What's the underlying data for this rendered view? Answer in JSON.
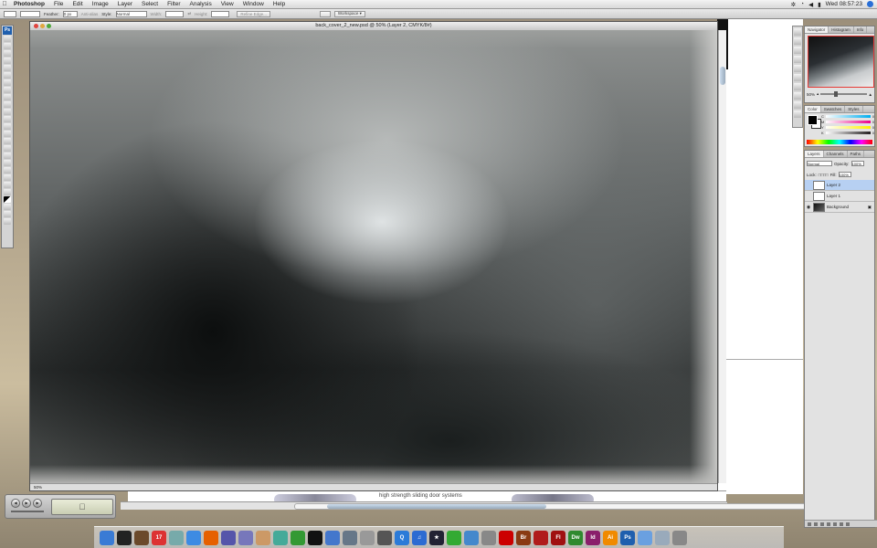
{
  "menubar": {
    "app": "Photoshop",
    "menus": [
      "File",
      "Edit",
      "Image",
      "Layer",
      "Select",
      "Filter",
      "Analysis",
      "View",
      "Window",
      "Help"
    ],
    "clock": "Wed 08:57:23"
  },
  "options": {
    "feather_label": "Feather:",
    "feather_value": "0 px",
    "antialias_label": "Anti-alias",
    "style_label": "Style:",
    "style_value": "Normal",
    "width_label": "Width:",
    "height_label": "Height:",
    "refine_edge": "Refine Edge...",
    "workspace": "Workspace ▾"
  },
  "tools": {
    "logo": "Ps"
  },
  "document": {
    "title": "back_cover_2_new.psd @ 50% (Layer 2, CMYK/8#)",
    "status": "50%"
  },
  "lower_document": {
    "caption": "high strength sliding door systems"
  },
  "panels": {
    "navigator_tabs": [
      "Navigator",
      "Histogram",
      "Info"
    ],
    "zoom_value": "50%",
    "color_tabs": [
      "Color",
      "Swatches",
      "Styles"
    ],
    "color_channels": [
      {
        "label": "C",
        "value": "0",
        "color": "#00aeef"
      },
      {
        "label": "M",
        "value": "0",
        "color": "#ec008c"
      },
      {
        "label": "Y",
        "value": "0",
        "color": "#fff200"
      },
      {
        "label": "K",
        "value": "0",
        "color": "#231f20"
      }
    ],
    "layers_tabs": [
      "Layers",
      "Channels",
      "Paths"
    ],
    "blend_mode": "Normal",
    "opacity_label": "Opacity:",
    "opacity_value": "100%",
    "lock_label": "Lock:",
    "fill_label": "Fill:",
    "fill_value": "100%",
    "layers": [
      {
        "name": "Layer 2",
        "selected": true
      },
      {
        "name": "Layer 1",
        "selected": false
      },
      {
        "name": "Background",
        "selected": false
      }
    ]
  },
  "dock": {
    "items": [
      {
        "name": "finder-icon",
        "label": "",
        "color": "#3a7bd5"
      },
      {
        "name": "dashboard-icon",
        "label": "",
        "color": "#222"
      },
      {
        "name": "books-icon",
        "label": "",
        "color": "#6b4a2b"
      },
      {
        "name": "ical-icon",
        "label": "17",
        "color": "#d33"
      },
      {
        "name": "preview-icon",
        "label": "",
        "color": "#7aa"
      },
      {
        "name": "safari-icon",
        "label": "",
        "color": "#3d8be3"
      },
      {
        "name": "firefox-icon",
        "label": "",
        "color": "#e66000"
      },
      {
        "name": "ichat-icon",
        "label": "",
        "color": "#55a"
      },
      {
        "name": "mail-icon",
        "label": "",
        "color": "#77b"
      },
      {
        "name": "photo-icon",
        "label": "",
        "color": "#c96"
      },
      {
        "name": "itunes-icon",
        "label": "",
        "color": "#4a9"
      },
      {
        "name": "adium-icon",
        "label": "",
        "color": "#393"
      },
      {
        "name": "terminal-icon",
        "label": "",
        "color": "#111"
      },
      {
        "name": "network-icon",
        "label": "",
        "color": "#47c"
      },
      {
        "name": "xcode-icon",
        "label": "",
        "color": "#678"
      },
      {
        "name": "text-icon",
        "label": "",
        "color": "#999"
      },
      {
        "name": "printer-icon",
        "label": "",
        "color": "#555"
      },
      {
        "name": "quicktime-icon",
        "label": "Q",
        "color": "#2b7bd8"
      },
      {
        "name": "music-icon",
        "label": "♫",
        "color": "#2c6bd2"
      },
      {
        "name": "star-icon",
        "label": "★",
        "color": "#223"
      },
      {
        "name": "chat-icon",
        "label": "",
        "color": "#3a3"
      },
      {
        "name": "pen-icon",
        "label": "",
        "color": "#48c"
      },
      {
        "name": "gear-icon",
        "label": "",
        "color": "#888"
      },
      {
        "name": "acrobat-icon",
        "label": "",
        "color": "#c00"
      },
      {
        "name": "bridge-icon",
        "label": "Br",
        "color": "#8a3a13"
      },
      {
        "name": "acrobat-pro-icon",
        "label": "",
        "color": "#b01c1c"
      },
      {
        "name": "flash-icon",
        "label": "Fl",
        "color": "#a01010"
      },
      {
        "name": "dreamweaver-icon",
        "label": "Dw",
        "color": "#2f8a2f"
      },
      {
        "name": "indesign-icon",
        "label": "Id",
        "color": "#8a1f6b"
      },
      {
        "name": "illustrator-icon",
        "label": "Ai",
        "color": "#f08a00"
      },
      {
        "name": "photoshop-icon",
        "label": "Ps",
        "color": "#1f5fae"
      },
      {
        "name": "folder-icon",
        "label": "",
        "color": "#6aa0e0"
      },
      {
        "name": "downloads-icon",
        "label": "",
        "color": "#9ab"
      },
      {
        "name": "trash-icon",
        "label": "",
        "color": "#888"
      }
    ]
  }
}
